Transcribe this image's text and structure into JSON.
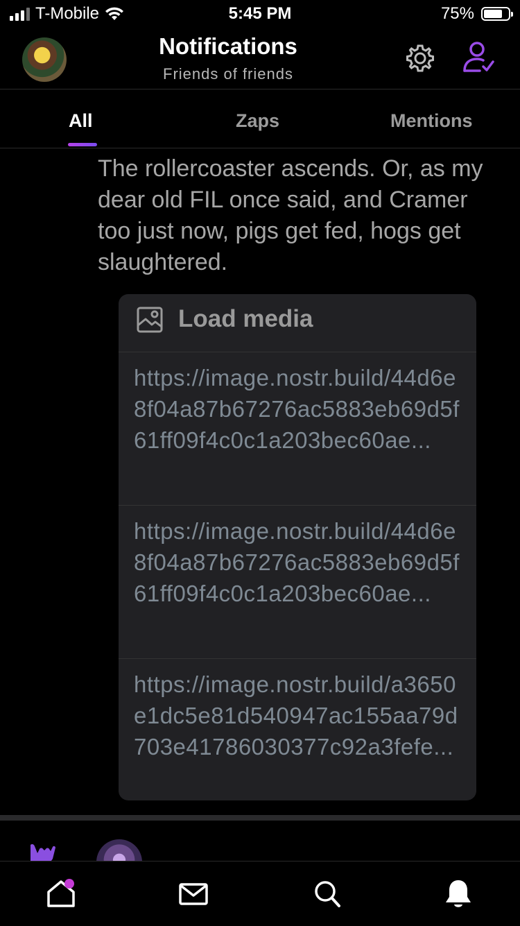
{
  "status_bar": {
    "carrier": "T-Mobile",
    "time": "5:45 PM",
    "battery": "75%",
    "battery_level": 0.75
  },
  "header": {
    "title": "Notifications",
    "subtitle": "Friends of friends"
  },
  "tabs": [
    {
      "label": "All",
      "active": true
    },
    {
      "label": "Zaps",
      "active": false
    },
    {
      "label": "Mentions",
      "active": false
    }
  ],
  "post": {
    "text": "The rollercoaster ascends.  Or, as my dear old FIL once said, and Cramer too just now, pigs get fed, hogs get slaughtered.",
    "media": {
      "load_label": "Load media",
      "links": [
        "https://image.nostr.build/44d6e8f04a87b67276ac5883eb69d5f61ff09f4c0c1a203bec60ae...",
        "https://image.nostr.build/44d6e8f04a87b67276ac5883eb69d5f61ff09f4c0c1a203bec60ae...",
        "https://image.nostr.build/a3650e1dc5e81d540947ac155aa79d703e41786030377c92a3fefe..."
      ]
    }
  },
  "colors": {
    "accent": "#b542e8",
    "background": "#000000",
    "card": "#212124",
    "link": "#7f8a94"
  },
  "icons": {
    "gear": "gear-icon",
    "follow": "user-check-icon",
    "home": "home-icon",
    "messages": "mail-icon",
    "search": "search-icon",
    "notifications": "bell-icon",
    "media": "image-icon",
    "shaka": "shaka-hand-icon"
  }
}
